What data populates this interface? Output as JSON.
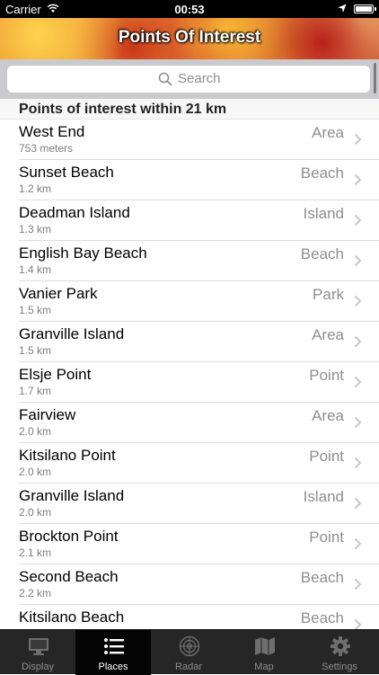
{
  "status": {
    "carrier": "Carrier",
    "time": "00:53"
  },
  "nav": {
    "title": "Points Of Interest"
  },
  "search": {
    "placeholder": "Search"
  },
  "section": {
    "title": "Points of interest within 21 km"
  },
  "items": [
    {
      "name": "West End",
      "distance": "753 meters",
      "type": "Area"
    },
    {
      "name": "Sunset Beach",
      "distance": "1.2 km",
      "type": "Beach"
    },
    {
      "name": "Deadman Island",
      "distance": "1.3 km",
      "type": "Island"
    },
    {
      "name": "English Bay Beach",
      "distance": "1.4 km",
      "type": "Beach"
    },
    {
      "name": "Vanier Park",
      "distance": "1.5 km",
      "type": "Park"
    },
    {
      "name": "Granville Island",
      "distance": "1.5 km",
      "type": "Area"
    },
    {
      "name": "Elsje Point",
      "distance": "1.7 km",
      "type": "Point"
    },
    {
      "name": "Fairview",
      "distance": "2.0 km",
      "type": "Area"
    },
    {
      "name": "Kitsilano Point",
      "distance": "2.0 km",
      "type": "Point"
    },
    {
      "name": "Granville Island",
      "distance": "2.0 km",
      "type": "Island"
    },
    {
      "name": "Brockton Point",
      "distance": "2.1 km",
      "type": "Point"
    },
    {
      "name": "Second Beach",
      "distance": "2.2 km",
      "type": "Beach"
    },
    {
      "name": "Kitsilano Beach",
      "distance": "",
      "type": "Beach"
    }
  ],
  "tabs": [
    {
      "label": "Display",
      "icon": "display-icon",
      "active": false
    },
    {
      "label": "Places",
      "icon": "list-icon",
      "active": true
    },
    {
      "label": "Radar",
      "icon": "radar-icon",
      "active": false
    },
    {
      "label": "Map",
      "icon": "map-icon",
      "active": false
    },
    {
      "label": "Settings",
      "icon": "gear-icon",
      "active": false
    }
  ],
  "colors": {
    "accent": "#ffffff",
    "tabbar_bg": "#262626",
    "secondary_text": "#8e8e93"
  }
}
